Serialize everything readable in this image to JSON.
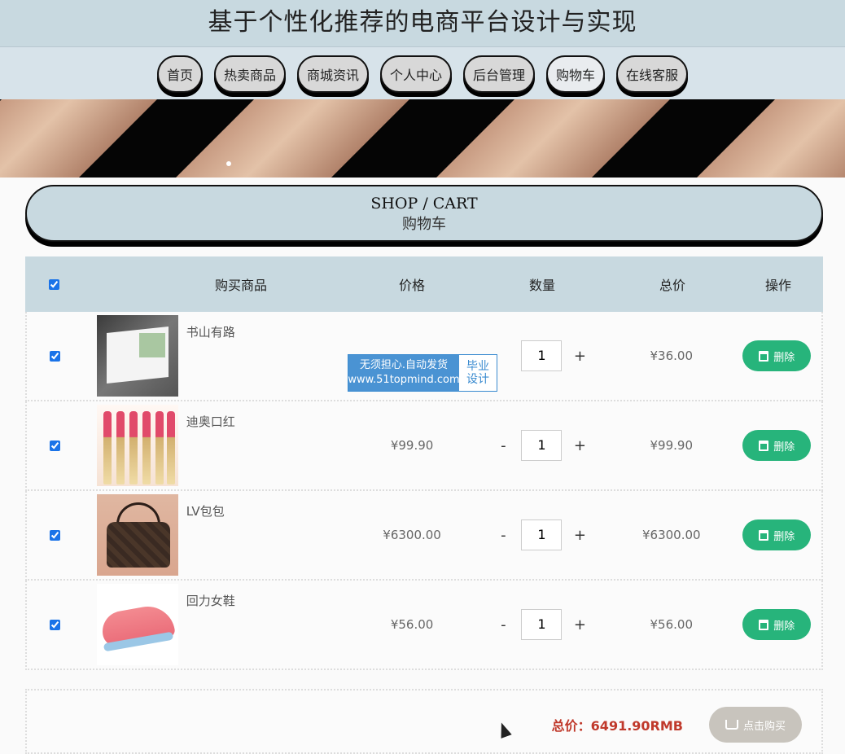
{
  "site": {
    "title": "基于个性化推荐的电商平台设计与实现"
  },
  "nav": {
    "items": [
      {
        "label": "首页"
      },
      {
        "label": "热卖商品"
      },
      {
        "label": "商城资讯"
      },
      {
        "label": "个人中心"
      },
      {
        "label": "后台管理"
      },
      {
        "label": "购物车"
      },
      {
        "label": "在线客服"
      }
    ],
    "active_index": 5
  },
  "cart_heading": {
    "en": "SHOP / CART",
    "cn": "购物车"
  },
  "table": {
    "headers": {
      "goods": "购买商品",
      "price": "价格",
      "qty": "数量",
      "total": "总价",
      "op": "操作"
    },
    "select_all_checked": true,
    "rows": [
      {
        "name": "书山有路",
        "price": "",
        "qty": "1",
        "total": "¥36.00",
        "checked": true,
        "delete_label": "删除",
        "minus": "",
        "plus": "+"
      },
      {
        "name": "迪奥口红",
        "price": "¥99.90",
        "qty": "1",
        "total": "¥99.90",
        "checked": true,
        "delete_label": "删除",
        "minus": "-",
        "plus": "+"
      },
      {
        "name": "LV包包",
        "price": "¥6300.00",
        "qty": "1",
        "total": "¥6300.00",
        "checked": true,
        "delete_label": "删除",
        "minus": "-",
        "plus": "+"
      },
      {
        "name": "回力女鞋",
        "price": "¥56.00",
        "qty": "1",
        "total": "¥56.00",
        "checked": true,
        "delete_label": "删除",
        "minus": "-",
        "plus": "+"
      }
    ]
  },
  "footer": {
    "total_text": "总价：6491.90RMB",
    "buy_label": "点击购买"
  },
  "watermark": {
    "line1": "无须担心.自动发货",
    "line2": "www.51topmind.com",
    "side1": "毕业",
    "side2": "设计"
  },
  "colors": {
    "header_bg": "#c8d9e0",
    "delete_btn": "#27b47b",
    "total_text": "#c0392b",
    "buy_btn": "#c8c4bd"
  }
}
